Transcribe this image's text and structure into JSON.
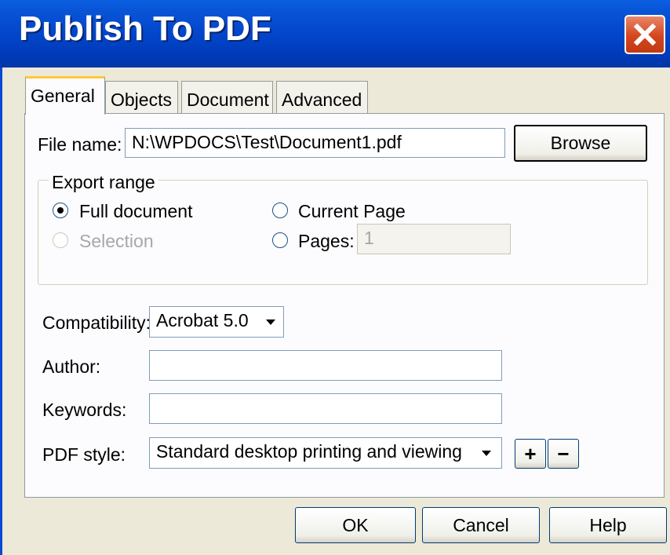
{
  "window": {
    "title": "Publish To PDF"
  },
  "tabs": [
    {
      "label": "General",
      "active": true
    },
    {
      "label": "Objects",
      "active": false
    },
    {
      "label": "Document",
      "active": false
    },
    {
      "label": "Advanced",
      "active": false
    }
  ],
  "file": {
    "label": "File name:",
    "value": "N:\\WPDOCS\\Test\\Document1.pdf",
    "browse_label": "Browse"
  },
  "export_range": {
    "title": "Export range",
    "full_document": {
      "label": "Full document",
      "selected": true
    },
    "current_page": {
      "label": "Current Page",
      "selected": false
    },
    "selection": {
      "label": "Selection",
      "enabled": false
    },
    "pages": {
      "label": "Pages:",
      "value": "1",
      "enabled": true
    }
  },
  "compatibility": {
    "label": "Compatibility:",
    "value": "Acrobat 5.0"
  },
  "author": {
    "label": "Author:",
    "value": ""
  },
  "keywords": {
    "label": "Keywords:",
    "value": ""
  },
  "pdf_style": {
    "label": "PDF style:",
    "value": "Standard desktop printing and viewing",
    "add_label": "+",
    "remove_label": "−"
  },
  "buttons": {
    "ok": "OK",
    "cancel": "Cancel",
    "help": "Help"
  },
  "colors": {
    "titlebar": "#0244C9",
    "close": "#D4461D",
    "dialog_bg": "#ECE9D8",
    "active_tab_accent": "#FFC83D"
  }
}
